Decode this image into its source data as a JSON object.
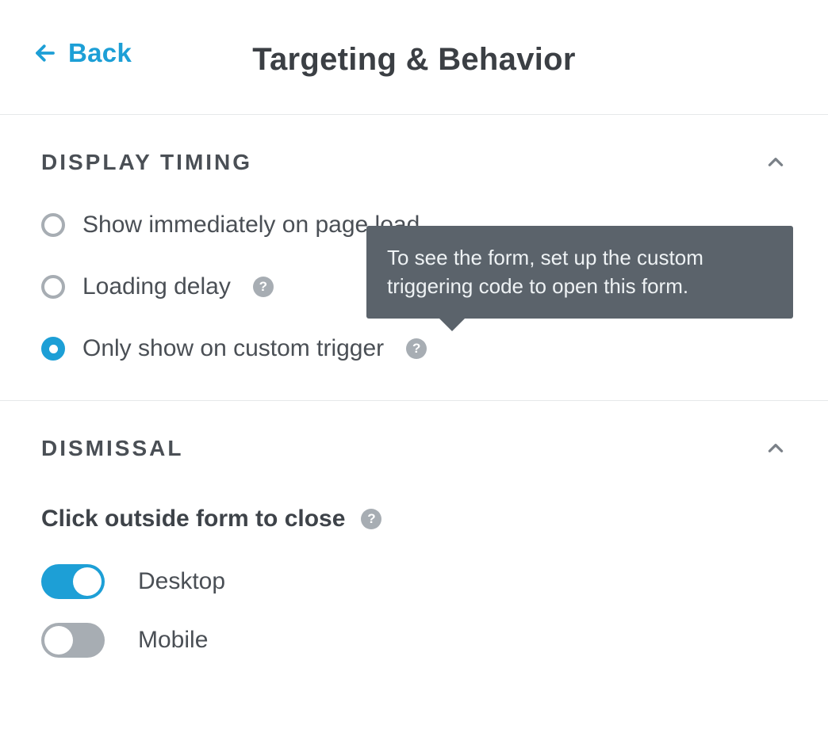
{
  "header": {
    "back_label": "Back",
    "title": "Targeting & Behavior"
  },
  "sections": {
    "display_timing": {
      "title": "DISPLAY TIMING",
      "options": [
        {
          "label": "Show immediately on page load",
          "selected": false,
          "has_help": false
        },
        {
          "label": "Loading delay",
          "selected": false,
          "has_help": true
        },
        {
          "label": "Only show on custom trigger",
          "selected": true,
          "has_help": true
        }
      ],
      "tooltip_text": "To see the form, set up the custom triggering code to open this form."
    },
    "dismissal": {
      "title": "DISMISSAL",
      "subtitle": "Click outside form to close",
      "toggles": [
        {
          "label": "Desktop",
          "on": true
        },
        {
          "label": "Mobile",
          "on": false
        }
      ]
    }
  },
  "colors": {
    "accent": "#1d9fd6",
    "text": "#3b3f44",
    "muted": "#a7adb3",
    "tooltip_bg": "#5b636b"
  }
}
